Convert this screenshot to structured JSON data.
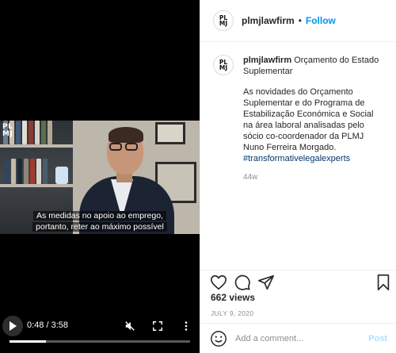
{
  "video": {
    "watermark": "PL\nMJ",
    "subtitle_line1": "As medidas no apoio ao emprego,",
    "subtitle_line2": "portanto, reter ao máximo possível",
    "current_time": "0:48",
    "duration": "3:58",
    "time_display": "0:48 / 3:58",
    "progress_fraction": 0.2
  },
  "header": {
    "avatar_text": "PL\nMJ",
    "username": "plmjlawfirm",
    "separator": "•",
    "follow_label": "Follow"
  },
  "caption": {
    "username": "plmjlawfirm",
    "title": "Orçamento do Estado Suplementar",
    "body": "As novidades do Orçamento Suplementar e do Programa de Estabilização Económica e Social na área laboral analisadas pelo sócio co-coordenador da PLMJ Nuno Ferreira Morgado.",
    "hashtag": "#transformativelegalexperts",
    "time_ago": "44w"
  },
  "stats": {
    "views": "662 views",
    "date": "JULY 9, 2020"
  },
  "comment": {
    "placeholder": "Add a comment...",
    "post_label": "Post"
  },
  "icons": {
    "like": "heart-icon",
    "comment": "comment-icon",
    "share": "paper-plane-icon",
    "save": "bookmark-icon",
    "emoji": "emoji-icon",
    "play": "play-icon",
    "mute": "muted-speaker-icon",
    "fullscreen": "fullscreen-icon",
    "more": "more-vertical-icon"
  },
  "colors": {
    "accent": "#0095f6",
    "post_disabled": "#b2dffc",
    "hashtag": "#00376b",
    "muted_text": "#8e8e8e"
  }
}
